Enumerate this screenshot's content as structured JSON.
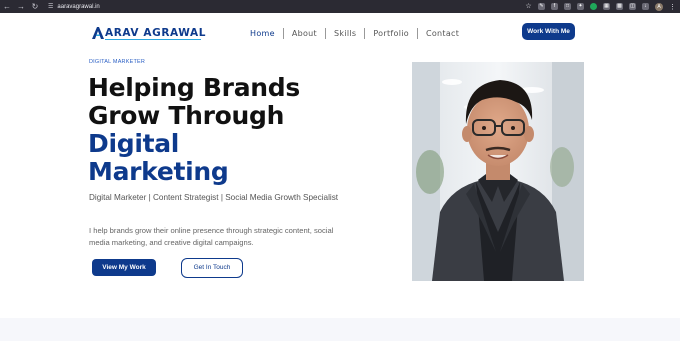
{
  "browser": {
    "url": "aaravagrawal.in",
    "profile_initial": "A"
  },
  "header": {
    "logo_text": "ARAV AGRAWAL",
    "nav": [
      "Home",
      "About",
      "Skills",
      "Portfolio",
      "Contact"
    ],
    "cta_label": "Work With Me"
  },
  "hero": {
    "kicker": "DIGITAL MARKETER",
    "title_line1": "Helping Brands",
    "title_line2": "Grow Through",
    "title_accent_line1": "Digital",
    "title_accent_line2": "Marketing",
    "subtitle": "Digital Marketer | Content Strategist | Social Media Growth Specialist",
    "description": "I help brands grow their online presence through strategic content, social media marketing, and creative digital campaigns.",
    "primary_button": "View My Work",
    "secondary_button": "Get In Touch"
  },
  "colors": {
    "brand": "#0e3a8c",
    "accent": "#2aa7e0",
    "chrome": "#2b2a33"
  }
}
